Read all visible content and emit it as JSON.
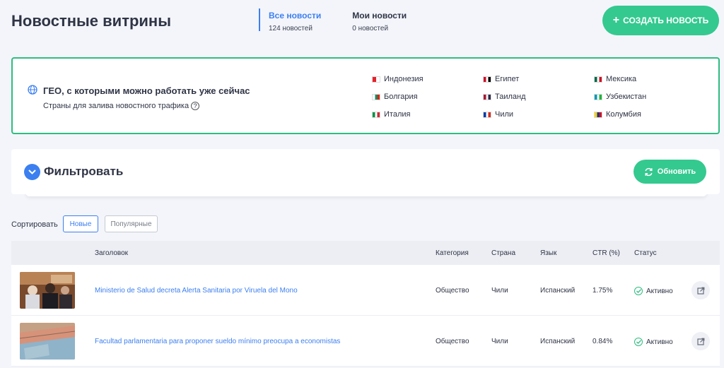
{
  "header": {
    "title": "Новостные витрины",
    "tabs": [
      {
        "label": "Все новости",
        "count": "124 новостей",
        "active": true
      },
      {
        "label": "Мои новости",
        "count": "0 новостей",
        "active": false
      }
    ],
    "create_button": "СОЗДАТЬ НОВОСТЬ",
    "create_icon": "plus-icon"
  },
  "geo": {
    "icon": "globe-icon",
    "title": "ГЕО, с которыми можно работать уже сейчас",
    "subtitle": "Страны для залива новостного трафика",
    "countries": [
      {
        "name": "Индонезия",
        "colors": [
          "#e8202a",
          "#ffffff"
        ]
      },
      {
        "name": "Египет",
        "colors": [
          "#ce1126",
          "#ffffff",
          "#000000"
        ]
      },
      {
        "name": "Мексика",
        "colors": [
          "#006847",
          "#ffffff",
          "#ce1126"
        ]
      },
      {
        "name": "Болгария",
        "colors": [
          "#ffffff",
          "#00966e",
          "#d62612"
        ]
      },
      {
        "name": "Таиланд",
        "colors": [
          "#a51931",
          "#f4f5f8",
          "#2d2a4a"
        ]
      },
      {
        "name": "Узбекистан",
        "colors": [
          "#0099b5",
          "#ffffff",
          "#1eb53a"
        ]
      },
      {
        "name": "Италия",
        "colors": [
          "#009246",
          "#ffffff",
          "#ce2b37"
        ]
      },
      {
        "name": "Чили",
        "colors": [
          "#0039a6",
          "#ffffff",
          "#d52b1e"
        ]
      },
      {
        "name": "Колумбия",
        "colors": [
          "#fcd116",
          "#003893",
          "#ce1126"
        ]
      }
    ]
  },
  "filter": {
    "title": "Фильтровать",
    "refresh_button": "Обновить"
  },
  "sort": {
    "label": "Сортировать",
    "options": [
      "Новые",
      "Популярные"
    ],
    "selected": "Новые"
  },
  "table": {
    "headers": {
      "title": "Заголовок",
      "category": "Категория",
      "country": "Страна",
      "language": "Язык",
      "ctr": "CTR (%)",
      "status": "Статус"
    },
    "rows": [
      {
        "title": "Ministerio de Salud decreta Alerta Sanitaria por Viruela del Mono",
        "category": "Общество",
        "country": "Чили",
        "language": "Испанский",
        "ctr": "1.75%",
        "status": "Активно"
      },
      {
        "title": "Facultad parlamentaria para proponer sueldo mínimo preocupa a economistas",
        "category": "Общество",
        "country": "Чили",
        "language": "Испанский",
        "ctr": "0.84%",
        "status": "Активно"
      }
    ]
  },
  "colors": {
    "accent": "#3c7ff0",
    "green": "#34c98f",
    "geo_border": "#2ebd80"
  }
}
